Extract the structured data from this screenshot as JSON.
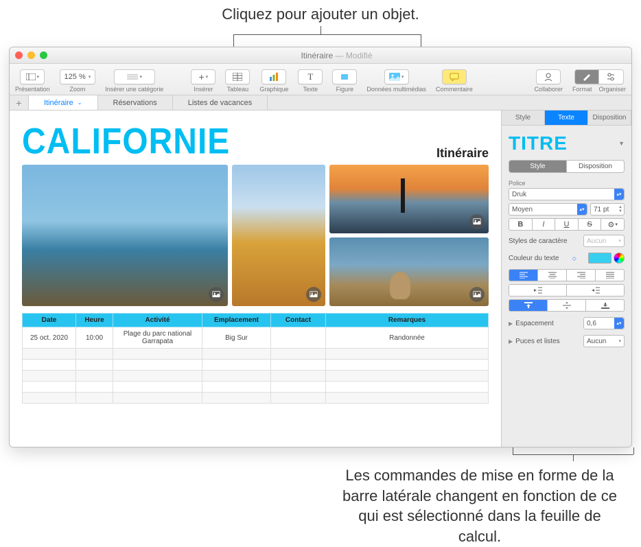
{
  "annotations": {
    "top": "Cliquez pour ajouter un objet.",
    "bottom": "Les commandes de mise en forme de la barre latérale changent en fonction de ce qui est sélectionné dans la feuille de calcul."
  },
  "window": {
    "title": "Itinéraire",
    "modified": " — Modifié"
  },
  "toolbar": {
    "presentation": "Présentation",
    "zoom_value": "125 %",
    "zoom": "Zoom",
    "insert_category": "Insérer une catégorie",
    "insert": "Insérer",
    "table": "Tableau",
    "chart": "Graphique",
    "text": "Texte",
    "shape": "Figure",
    "media": "Données multimédias",
    "comment": "Commentaire",
    "collaborate": "Collaborer",
    "format": "Format",
    "organize": "Organiser"
  },
  "sheets": {
    "tab1": "Itinéraire",
    "tab2": "Réservations",
    "tab3": "Listes de vacances"
  },
  "canvas": {
    "title": "CALIFORNIE",
    "subtitle": "Itinéraire"
  },
  "table": {
    "headers": [
      "Date",
      "Heure",
      "Activité",
      "Emplacement",
      "Contact",
      "Remarques"
    ],
    "row1": {
      "date": "25 oct. 2020",
      "heure": "10:00",
      "activite": "Plage du parc national Garrapata",
      "emplacement": "Big Sur",
      "contact": "",
      "remarques": "Randonnée"
    }
  },
  "inspector": {
    "tabs": {
      "style": "Style",
      "text": "Texte",
      "arrange": "Disposition"
    },
    "titre": "TITRE",
    "seg_style": "Style",
    "seg_layout": "Disposition",
    "police_label": "Police",
    "font_name": "Druk",
    "font_weight": "Moyen",
    "font_size": "71 pt",
    "char_styles": "Styles de caractère",
    "char_styles_val": "Aucun",
    "text_color": "Couleur du texte",
    "spacing": "Espacement",
    "spacing_val": "0,6",
    "bullets": "Puces et listes",
    "bullets_val": "Aucun"
  }
}
